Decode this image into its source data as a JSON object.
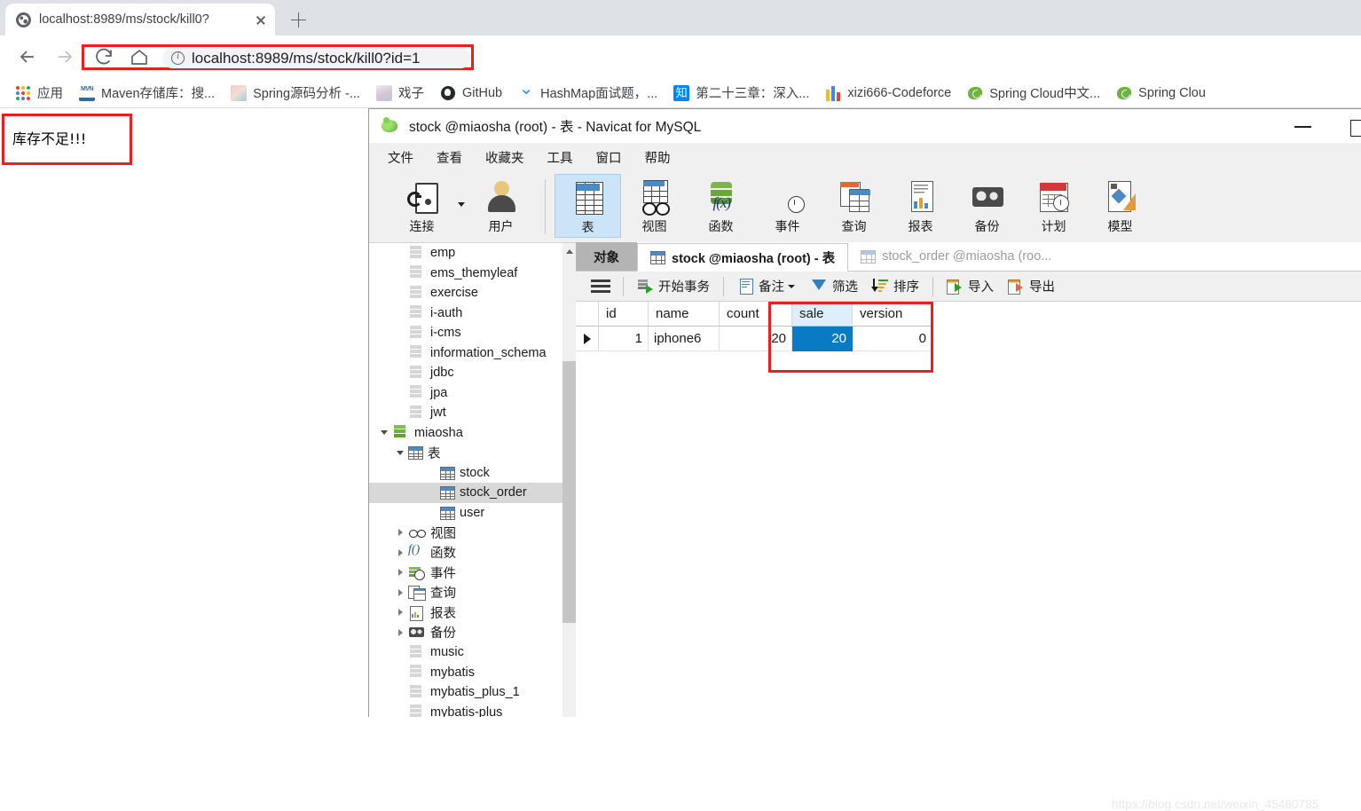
{
  "browser": {
    "tab": {
      "title": "localhost:8989/ms/stock/kill0?",
      "favicon": "globe-icon"
    },
    "newtab_tooltip": "+",
    "nav": {
      "back": "back-arrow-icon",
      "forward": "forward-arrow-icon",
      "reload": "reload-icon",
      "home": "home-icon"
    },
    "omnibox": {
      "info_icon": "info-circle-icon",
      "url_host": "localhost",
      "url_path": ":8989/ms/stock/kill0?id=1",
      "url_full": "localhost:8989/ms/stock/kill0?id=1",
      "highlight_color": "#f01d1d"
    },
    "bookmarks": [
      {
        "label": "应用",
        "icon": "apps-grid-icon"
      },
      {
        "label": "Maven存储库：搜...",
        "icon": "maven-icon"
      },
      {
        "label": "Spring源码分析 -...",
        "icon": "anime-avatar-icon"
      },
      {
        "label": "戏子",
        "icon": "anime-avatar2-icon"
      },
      {
        "label": "GitHub",
        "icon": "github-icon"
      },
      {
        "label": "HashMap面试题，...",
        "icon": "chevron-double-down-icon"
      },
      {
        "label": "第二十三章：深入...",
        "icon": "zhihu-icon"
      },
      {
        "label": "xizi666-Codeforce",
        "icon": "bar-chart-icon"
      },
      {
        "label": "Spring Cloud中文...",
        "icon": "spring-leaf-icon"
      },
      {
        "label": "Spring Clou",
        "icon": "spring-leaf-icon"
      }
    ]
  },
  "page": {
    "error_message": "库存不足!!!",
    "error_box_color": "#f01d1d",
    "watermark": "https://blog.csdn.net/weixin_45480785"
  },
  "navicat": {
    "window": {
      "title": "stock @miaosha (root) - 表 - Navicat for MySQL",
      "app_icon": "navicat-logo-icon",
      "minimize": "minimize-icon",
      "maximize": "maximize-icon"
    },
    "menus": [
      "文件",
      "查看",
      "收藏夹",
      "工具",
      "窗口",
      "帮助"
    ],
    "toolbar": [
      {
        "label": "连接",
        "icon": "connection-icon",
        "selected": false,
        "has_caret": true
      },
      {
        "label": "用户",
        "icon": "user-icon",
        "selected": false,
        "has_caret": false
      },
      {
        "label": "表",
        "icon": "table-icon",
        "selected": true,
        "has_caret": false
      },
      {
        "label": "视图",
        "icon": "view-glasses-icon",
        "selected": false,
        "has_caret": false
      },
      {
        "label": "函数",
        "icon": "function-fx-icon",
        "selected": false,
        "has_caret": false
      },
      {
        "label": "事件",
        "icon": "event-clock-icon",
        "selected": false,
        "has_caret": false
      },
      {
        "label": "查询",
        "icon": "query-icon",
        "selected": false,
        "has_caret": false
      },
      {
        "label": "报表",
        "icon": "report-icon",
        "selected": false,
        "has_caret": false
      },
      {
        "label": "备份",
        "icon": "backup-tape-icon",
        "selected": false,
        "has_caret": false
      },
      {
        "label": "计划",
        "icon": "schedule-calendar-icon",
        "selected": false,
        "has_caret": false
      },
      {
        "label": "模型",
        "icon": "model-diagram-icon",
        "selected": false,
        "has_caret": false
      }
    ],
    "sidebar": {
      "scrollbar": "vertical-scrollbar",
      "tree": [
        {
          "label": "emp",
          "icon": "database-icon",
          "indent": 1,
          "twisty": "none",
          "selected": false
        },
        {
          "label": "ems_themyleaf",
          "icon": "database-icon",
          "indent": 1,
          "twisty": "none",
          "selected": false
        },
        {
          "label": "exercise",
          "icon": "database-icon",
          "indent": 1,
          "twisty": "none",
          "selected": false
        },
        {
          "label": "i-auth",
          "icon": "database-icon",
          "indent": 1,
          "twisty": "none",
          "selected": false
        },
        {
          "label": "i-cms",
          "icon": "database-icon",
          "indent": 1,
          "twisty": "none",
          "selected": false
        },
        {
          "label": "information_schema",
          "icon": "database-icon",
          "indent": 1,
          "twisty": "none",
          "selected": false
        },
        {
          "label": "jdbc",
          "icon": "database-icon",
          "indent": 1,
          "twisty": "none",
          "selected": false
        },
        {
          "label": "jpa",
          "icon": "database-icon",
          "indent": 1,
          "twisty": "none",
          "selected": false
        },
        {
          "label": "jwt",
          "icon": "database-icon",
          "indent": 1,
          "twisty": "none",
          "selected": false
        },
        {
          "label": "miaosha",
          "icon": "database-active-icon",
          "indent": 0,
          "twisty": "down",
          "selected": false
        },
        {
          "label": "表",
          "icon": "table-icon",
          "indent": 1,
          "twisty": "down",
          "selected": false
        },
        {
          "label": "stock",
          "icon": "table-icon",
          "indent": 3,
          "twisty": "none",
          "selected": false
        },
        {
          "label": "stock_order",
          "icon": "table-icon",
          "indent": 3,
          "twisty": "none",
          "selected": true
        },
        {
          "label": "user",
          "icon": "table-icon",
          "indent": 3,
          "twisty": "none",
          "selected": false
        },
        {
          "label": "视图",
          "icon": "view-glasses-icon",
          "indent": 1,
          "twisty": "right",
          "selected": false
        },
        {
          "label": "函数",
          "icon": "function-fx-icon",
          "indent": 1,
          "twisty": "right",
          "selected": false
        },
        {
          "label": "事件",
          "icon": "event-clock-icon",
          "indent": 1,
          "twisty": "right",
          "selected": false
        },
        {
          "label": "查询",
          "icon": "query-icon",
          "indent": 1,
          "twisty": "right",
          "selected": false
        },
        {
          "label": "报表",
          "icon": "report-icon",
          "indent": 1,
          "twisty": "right",
          "selected": false
        },
        {
          "label": "备份",
          "icon": "backup-tape-icon",
          "indent": 1,
          "twisty": "right",
          "selected": false
        },
        {
          "label": "music",
          "icon": "database-icon",
          "indent": 1,
          "twisty": "none",
          "selected": false
        },
        {
          "label": "mybatis",
          "icon": "database-icon",
          "indent": 1,
          "twisty": "none",
          "selected": false
        },
        {
          "label": "mybatis_plus_1",
          "icon": "database-icon",
          "indent": 1,
          "twisty": "none",
          "selected": false
        },
        {
          "label": "mybatis-plus",
          "icon": "database-icon",
          "indent": 1,
          "twisty": "none",
          "selected": false
        }
      ]
    },
    "tabs": [
      {
        "label": "对象",
        "state": "object",
        "icon": null
      },
      {
        "label": "stock @miaosha (root) - 表",
        "state": "active",
        "icon": "table-icon"
      },
      {
        "label": "stock_order @miaosha (roo...",
        "state": "inactive",
        "icon": "table-icon"
      }
    ],
    "grid_toolbar": [
      {
        "label": "",
        "icon": "hamburger-menu-icon"
      },
      {
        "label": "开始事务",
        "icon": "begin-transaction-icon"
      },
      {
        "label": "备注",
        "icon": "note-icon",
        "caret": true
      },
      {
        "label": "筛选",
        "icon": "filter-icon"
      },
      {
        "label": "排序",
        "icon": "sort-icon"
      },
      {
        "label": "导入",
        "icon": "import-icon"
      },
      {
        "label": "导出",
        "icon": "export-icon"
      }
    ],
    "grid": {
      "columns": [
        "id",
        "name",
        "count",
        "sale",
        "version"
      ],
      "highlighted_column": "sale",
      "rows": [
        {
          "marker": true,
          "id": "1",
          "name": "iphone6",
          "count": "20",
          "sale": "20",
          "version": "0"
        }
      ],
      "selected_cell": {
        "row": 0,
        "column": "sale",
        "value": "20",
        "color": "#0a7ac4"
      },
      "annotation_color": "#f01d1d"
    }
  }
}
